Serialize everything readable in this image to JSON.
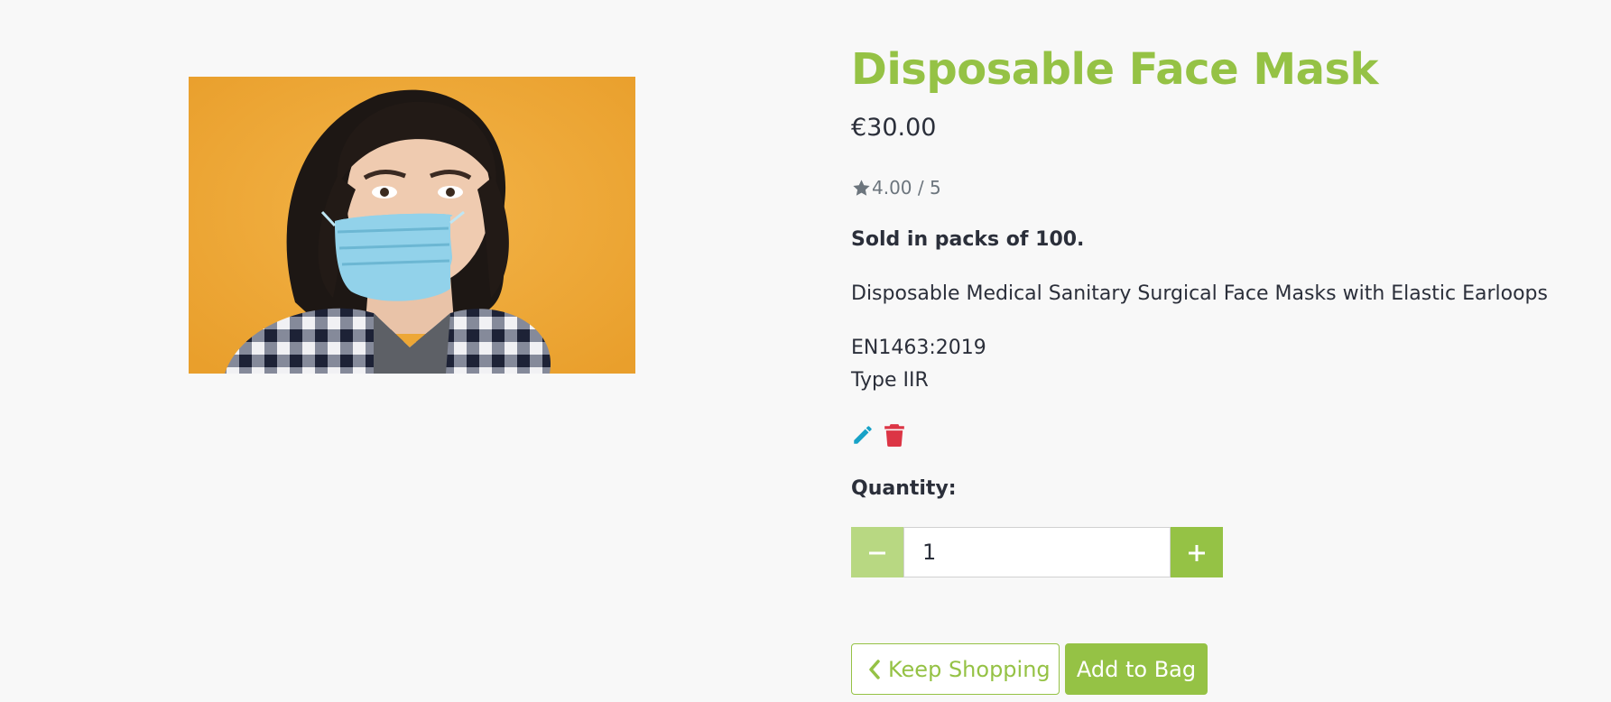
{
  "product": {
    "title": "Disposable Face Mask",
    "price": "€30.00",
    "rating_text": "4.00 / 5",
    "rating_value": 4.0,
    "rating_max": 5,
    "rating_icon": "star-icon",
    "packs_note": "Sold in packs of 100.",
    "description": "Disposable Medical Sanitary Surgical Face Masks with Elastic Earloops",
    "spec_line_1": "EN1463:2019",
    "spec_line_2": "Type IIR",
    "image_subject": "woman-wearing-surgical-mask"
  },
  "admin": {
    "edit_icon": "pencil-icon",
    "delete_icon": "trash-icon"
  },
  "quantity": {
    "label": "Quantity:",
    "value": "1",
    "decrement_icon": "minus-icon",
    "increment_icon": "plus-icon"
  },
  "actions": {
    "keep_shopping_label": "Keep Shopping",
    "keep_shopping_icon": "chevron-left-icon",
    "add_to_bag_label": "Add to Bag"
  },
  "colors": {
    "accent": "#95c245",
    "accent_light": "#b8d882",
    "edit": "#17a2c7",
    "delete": "#dc3545",
    "text": "#2b2f3a",
    "muted": "#6c757d",
    "background": "#f8f8f8"
  }
}
